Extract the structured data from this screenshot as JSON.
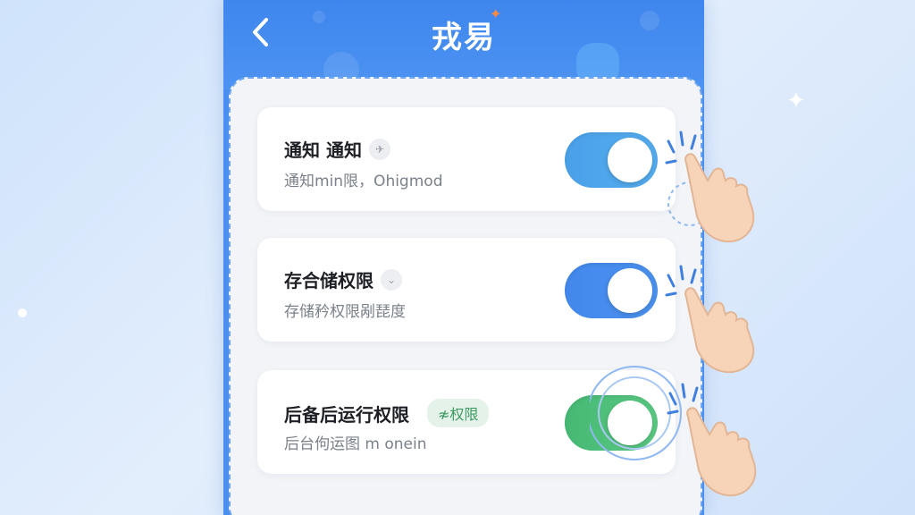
{
  "screen": {
    "title": "戎易",
    "colors": {
      "header": "#3f86ee",
      "toggle_blue_1": "#4fa5ea",
      "toggle_blue_2": "#4a90ee",
      "toggle_green": "#52c27c",
      "tag_green": "#3c9a62"
    }
  },
  "permissions": [
    {
      "title": "通知 通知",
      "icon": "pin-icon",
      "description": "通知min限，Ohigmod",
      "enabled": true
    },
    {
      "title": "存合储权限",
      "icon": "chevron-icon",
      "description": "存储矜权限剐琵度",
      "enabled": true
    },
    {
      "title": "后备后运行权限",
      "tag": "≉权限",
      "description": "后台佝运图 m onein",
      "enabled": true
    }
  ]
}
